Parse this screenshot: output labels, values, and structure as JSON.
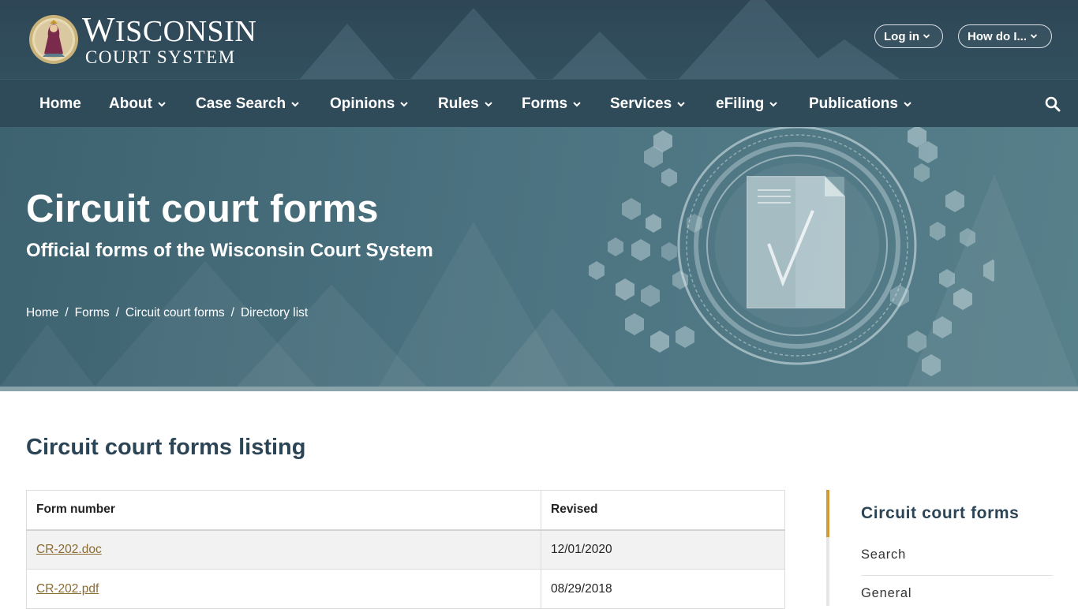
{
  "header": {
    "logo_line1_initial": "W",
    "logo_line1_rest": "ISCONSIN",
    "logo_line2": "COURT SYSTEM",
    "login_label": "Log in",
    "howdo_label": "How do I..."
  },
  "nav": {
    "items": [
      {
        "label": "Home",
        "has_dropdown": false
      },
      {
        "label": "About",
        "has_dropdown": true
      },
      {
        "label": "Case Search",
        "has_dropdown": true
      },
      {
        "label": "Opinions",
        "has_dropdown": true
      },
      {
        "label": "Rules",
        "has_dropdown": true
      },
      {
        "label": "Forms",
        "has_dropdown": true
      },
      {
        "label": "Services",
        "has_dropdown": true
      },
      {
        "label": "eFiling",
        "has_dropdown": true
      },
      {
        "label": "Publications",
        "has_dropdown": true
      }
    ],
    "search_icon": "search-icon"
  },
  "hero": {
    "title": "Circuit court forms",
    "subtitle": "Official forms of the Wisconsin Court System",
    "breadcrumb": [
      "Home",
      "Forms",
      "Circuit court forms",
      "Directory list"
    ],
    "breadcrumb_separator": "/"
  },
  "main": {
    "section_title": "Circuit court forms listing",
    "table": {
      "headers": [
        "Form number",
        "Revised"
      ],
      "rows": [
        {
          "form": "CR-202.doc",
          "revised": "12/01/2020"
        },
        {
          "form": "CR-202.pdf",
          "revised": "08/29/2018"
        }
      ]
    }
  },
  "sidebar": {
    "title": "Circuit court forms",
    "links": [
      "Search",
      "General"
    ]
  },
  "colors": {
    "header_bg": "#2e4656",
    "nav_bg": "#2f4b5a",
    "hero_bg": "#4b7280",
    "heading_text": "#2c4556",
    "link_gold": "#8a6a2f",
    "sidebar_accent": "#d39a3a"
  }
}
